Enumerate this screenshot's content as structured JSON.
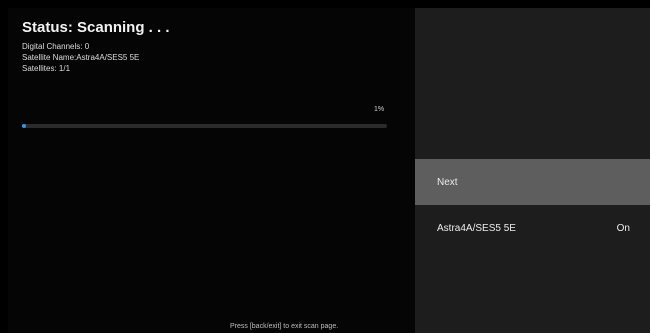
{
  "status": {
    "title": "Status: Scanning . . .",
    "digital_channels": "Digital Channels:  0",
    "satellite_name": "Satellite Name:Astra4A/SES5 5E",
    "satellites": "Satellites:  1/1"
  },
  "progress": {
    "percent_label": "1%",
    "value": 1,
    "color": "#3a8fe0"
  },
  "hint": "Press [back/exit] to exit scan page.",
  "menu": {
    "next_label": "Next",
    "satellite_label": "Astra4A/SES5 5E",
    "satellite_value": "On"
  }
}
